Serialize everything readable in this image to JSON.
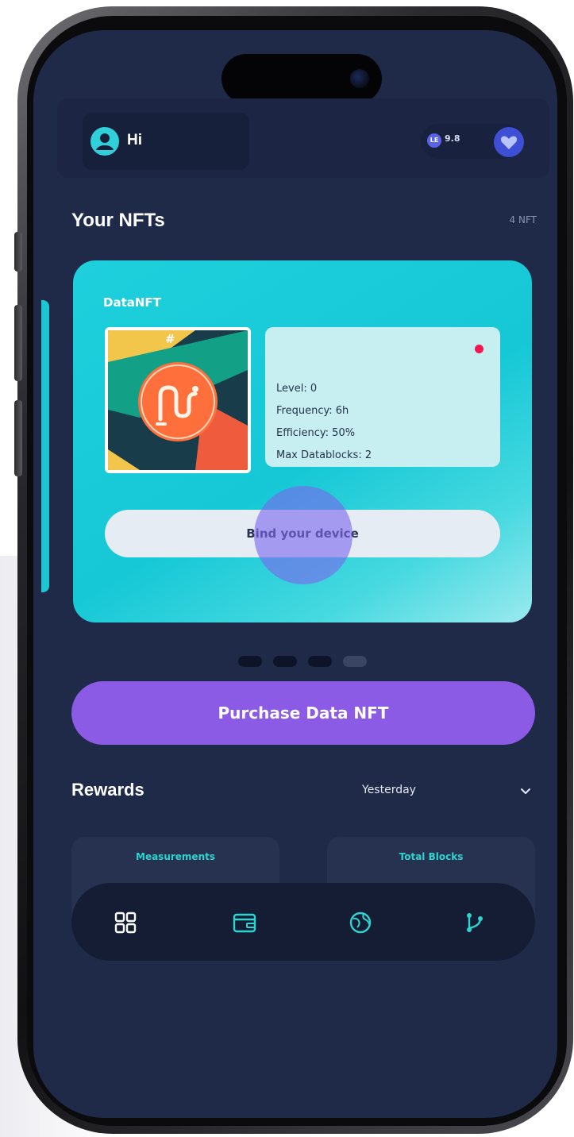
{
  "header": {
    "greeting": "Hi",
    "balance": "9.8",
    "token_symbol": "LE"
  },
  "nfts": {
    "section_title": "Your NFTs",
    "count_label": "4 NFT",
    "card": {
      "title": "DataNFT",
      "id_label": "#",
      "stats": [
        "Level: 0",
        "Frequency: 6h",
        "Efficiency: 50%",
        "Max Datablocks: 2"
      ],
      "status_color": "#f0174f",
      "bind_button": "Bind your device"
    },
    "pagination": {
      "total": 4,
      "active_index": 3
    }
  },
  "purchase_button": "Purchase Data NFT",
  "rewards": {
    "title": "Rewards",
    "period": "Yesterday",
    "cards": [
      {
        "label": "Measurements"
      },
      {
        "label": "Total Blocks"
      }
    ]
  },
  "tab_bar": {
    "items": [
      {
        "icon": "dashboard-grid-icon"
      },
      {
        "icon": "wallet-icon"
      },
      {
        "icon": "globe-icon"
      },
      {
        "icon": "branch-icon"
      }
    ]
  },
  "colors": {
    "screen_bg": "#1f2a48",
    "card_accent": "#1ecfdc",
    "purchase_button": "#8c5be6",
    "teal_text": "#2ed4cf"
  }
}
